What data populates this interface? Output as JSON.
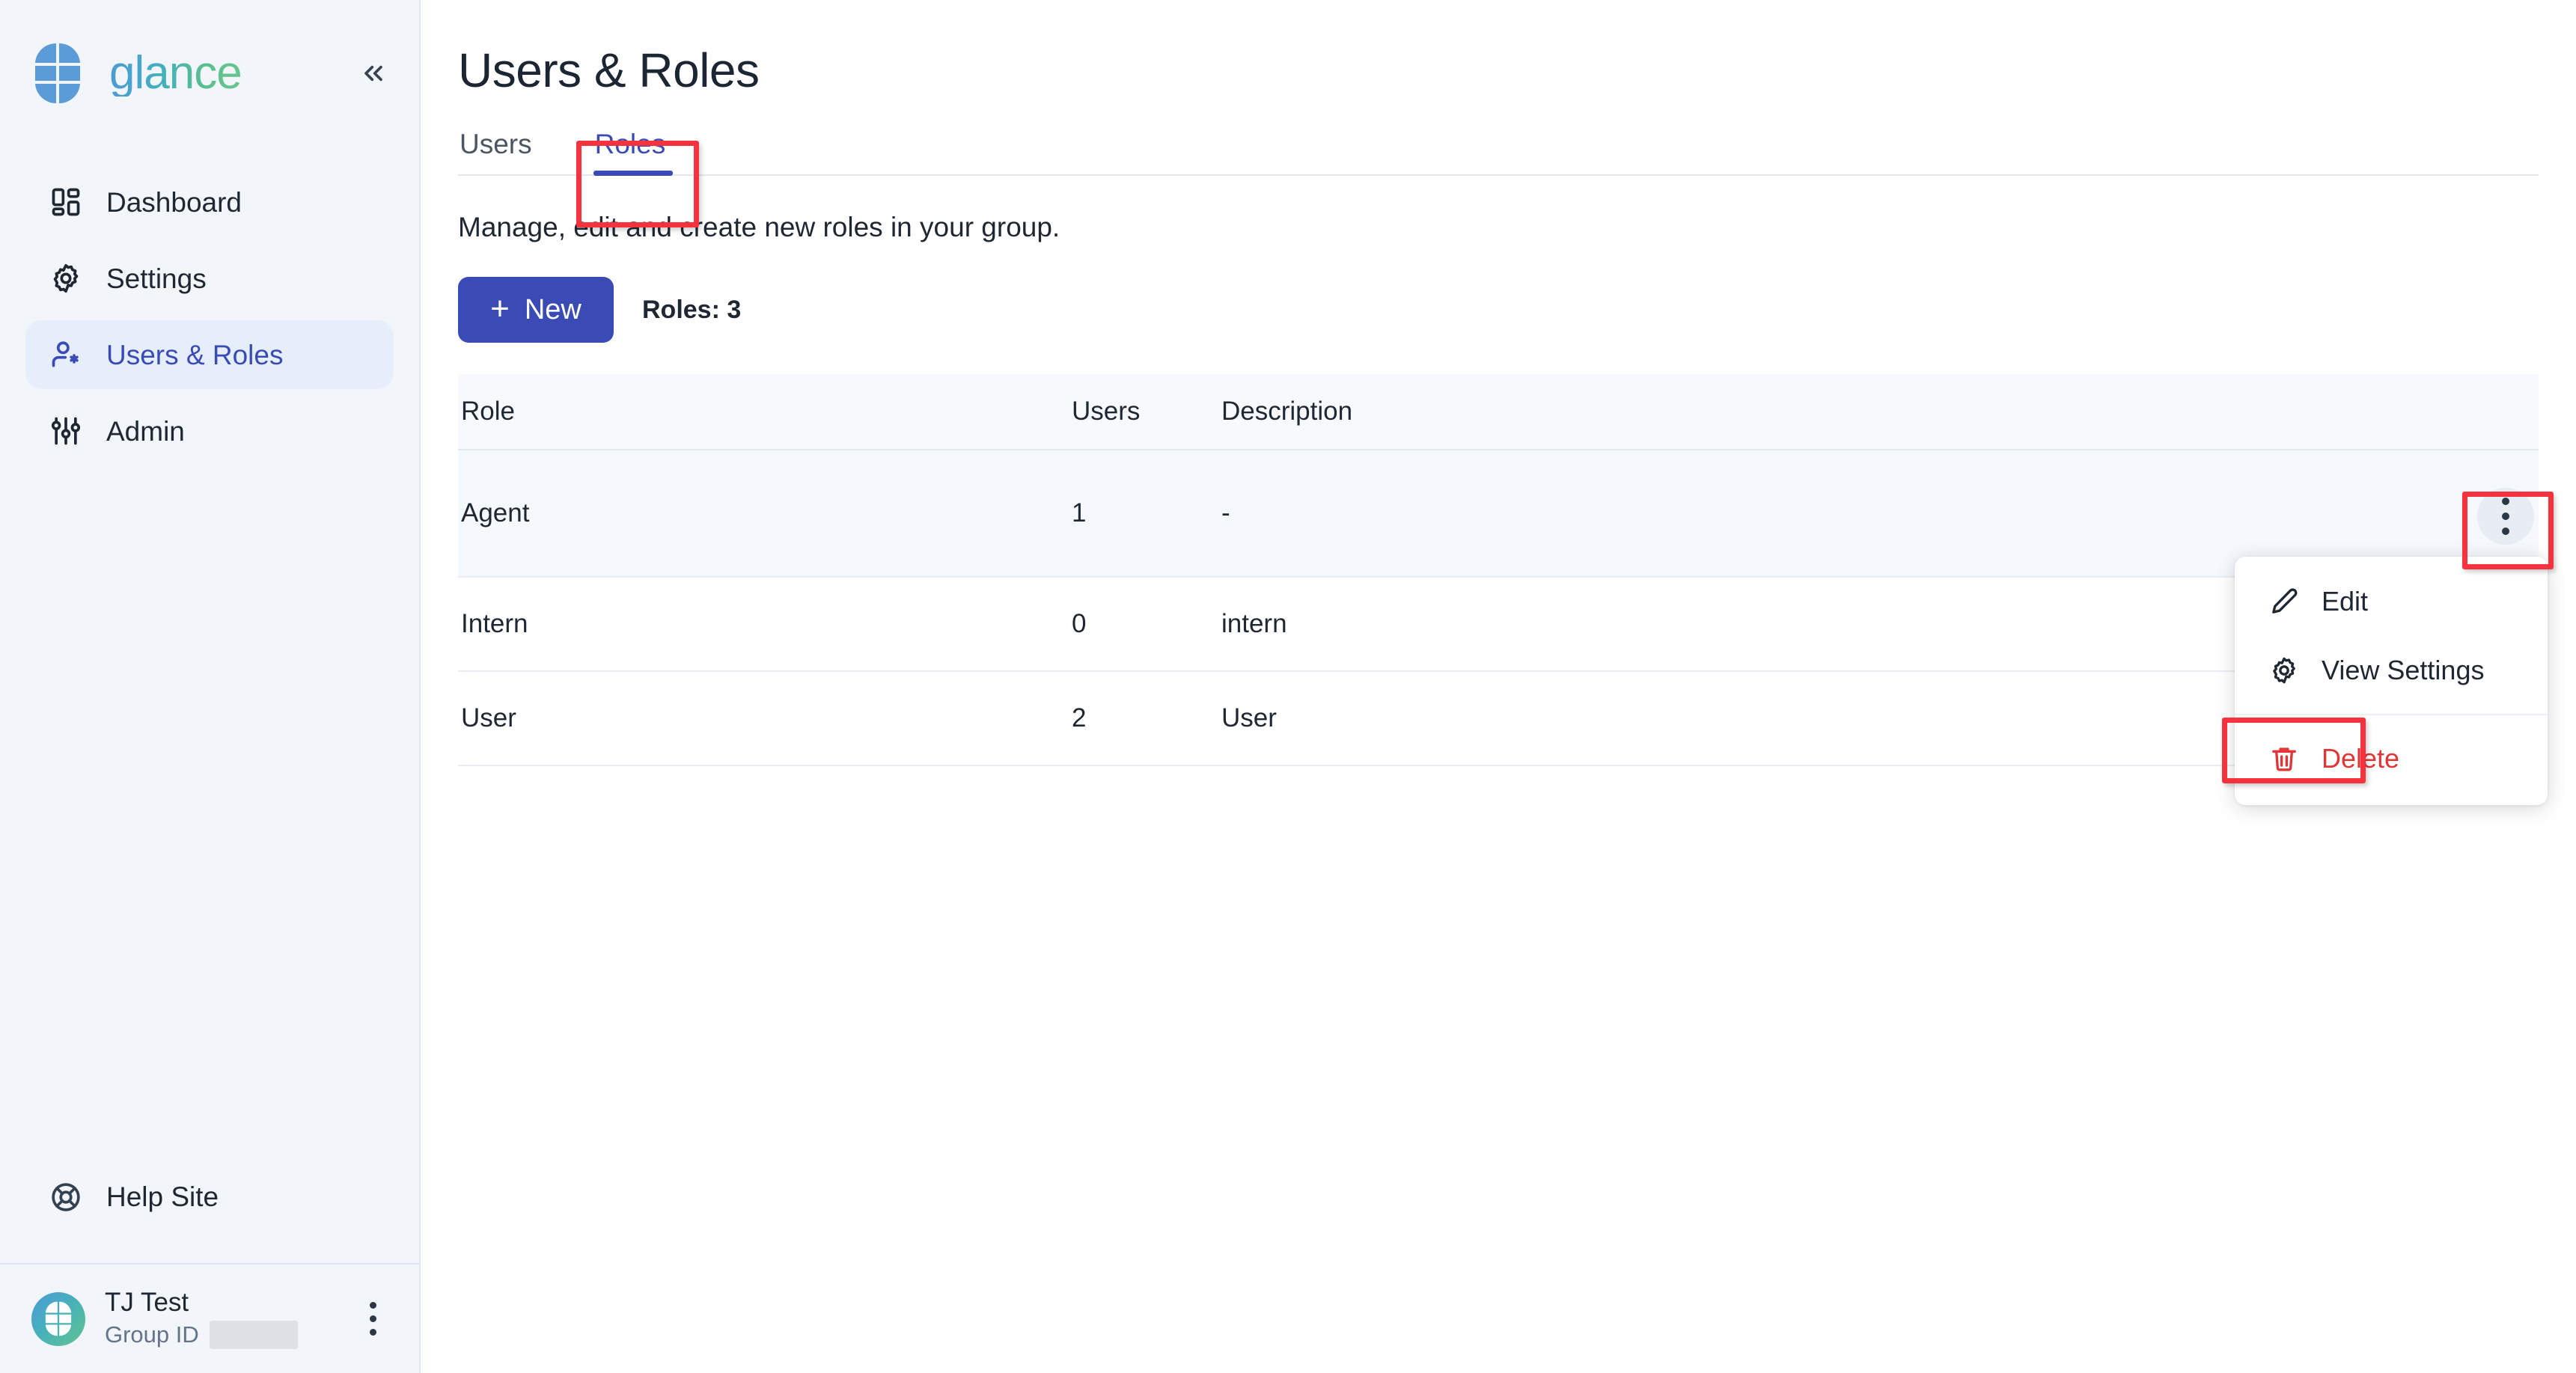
{
  "brand": {
    "name": "glance",
    "logo_icon": "glance-logo-icon",
    "collapse_icon": "chevrons-left-icon"
  },
  "sidebar": {
    "items": [
      {
        "label": "Dashboard",
        "icon": "layout-dashboard-icon",
        "active": false
      },
      {
        "label": "Settings",
        "icon": "gear-icon",
        "active": false
      },
      {
        "label": "Users & Roles",
        "icon": "user-star-icon",
        "active": true
      },
      {
        "label": "Admin",
        "icon": "sliders-icon",
        "active": false
      }
    ],
    "help": {
      "label": "Help Site",
      "icon": "lifebuoy-icon"
    },
    "profile": {
      "name": "TJ Test",
      "group_label": "Group ID",
      "group_value": "",
      "avatar_icon": "glance-avatar-icon",
      "menu_icon": "kebab-menu-icon"
    }
  },
  "main": {
    "title": "Users & Roles",
    "tabs": [
      {
        "label": "Users",
        "active": false
      },
      {
        "label": "Roles",
        "active": true
      }
    ],
    "subtitle": "Manage, edit and create new roles in your group.",
    "toolbar": {
      "new_label": "New",
      "new_icon": "plus-icon",
      "count_label": "Roles: 3"
    },
    "table": {
      "columns": [
        "Role",
        "Users",
        "Description",
        ""
      ],
      "rows": [
        {
          "role": "Agent",
          "users": "1",
          "description": "-",
          "highlight": true,
          "menu_icon": "kebab-menu-icon"
        },
        {
          "role": "Intern",
          "users": "0",
          "description": "intern",
          "highlight": false,
          "menu_icon": "kebab-menu-icon"
        },
        {
          "role": "User",
          "users": "2",
          "description": "User",
          "highlight": false,
          "menu_icon": "kebab-menu-icon"
        }
      ]
    },
    "dropdown": {
      "items": [
        {
          "label": "Edit",
          "icon": "pencil-icon",
          "danger": false
        },
        {
          "label": "View Settings",
          "icon": "gear-icon",
          "danger": false
        },
        {
          "label": "Delete",
          "icon": "trash-icon",
          "danger": true
        }
      ]
    }
  },
  "colors": {
    "accent": "#3a4bb5",
    "accent_soft": "#e6eefb",
    "danger": "#e03636",
    "annotation": "#f6323e",
    "sidebar_bg": "#f2f5f9",
    "row_highlight": "#f5f8fc",
    "table_header_bg": "#f7f9fc"
  }
}
